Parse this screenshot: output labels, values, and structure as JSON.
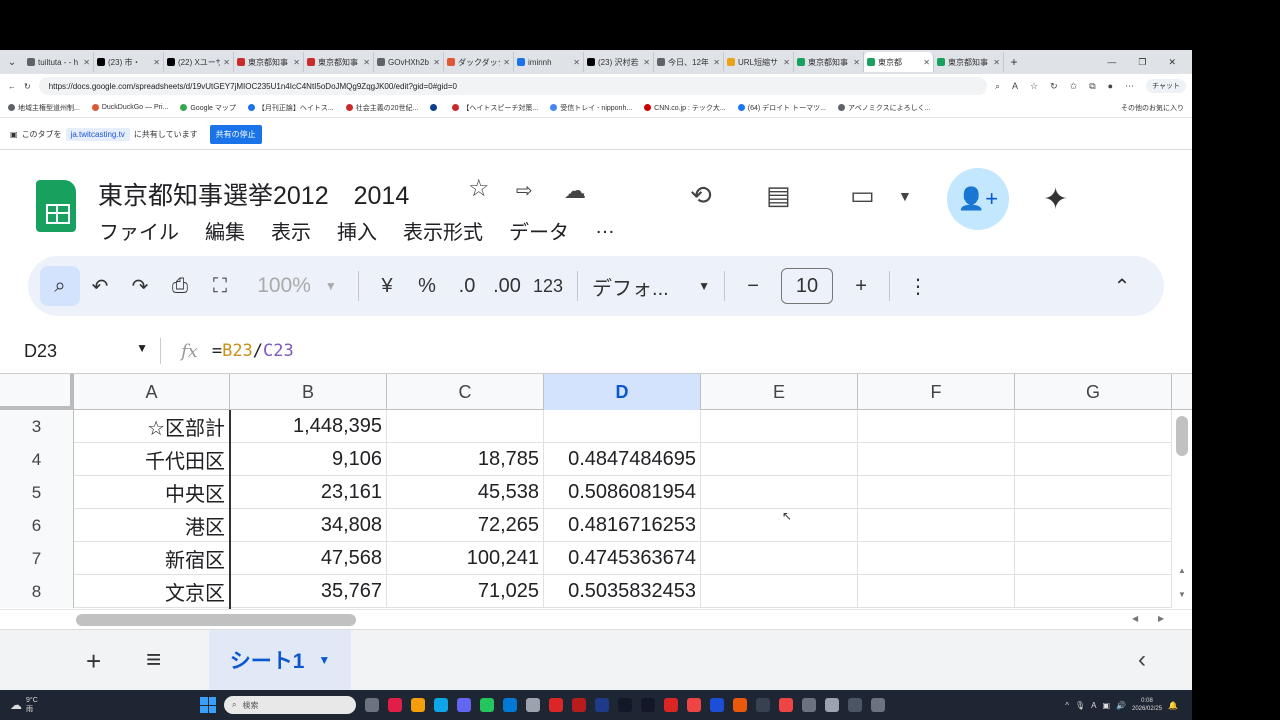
{
  "browser": {
    "tabs": [
      {
        "title": "tuiltuta - - h",
        "color": "#5f6368"
      },
      {
        "title": "(23) 市・",
        "color": "#000000"
      },
      {
        "title": "(22) Xユーザ",
        "color": "#000000"
      },
      {
        "title": "東京都知事",
        "color": "#c92a2a"
      },
      {
        "title": "東京都知事",
        "color": "#c92a2a"
      },
      {
        "title": "GOvHXh2b",
        "color": "#5f6368"
      },
      {
        "title": "ダックダックゴ",
        "color": "#de5833"
      },
      {
        "title": "iminnh",
        "color": "#1a73e8"
      },
      {
        "title": "(23) 沢村若",
        "color": "#000000"
      },
      {
        "title": "今日、12年",
        "color": "#5f6368"
      },
      {
        "title": "URL短縮サ",
        "color": "#e8a317"
      },
      {
        "title": "東京都知事",
        "color": "#18a15e"
      },
      {
        "title": "東京都",
        "color": "#18a15e",
        "active": true
      },
      {
        "title": "東京都知事",
        "color": "#18a15e"
      }
    ],
    "url": "https://docs.google.com/spreadsheets/d/19vUtGEY7jMIOC235U1n4IcC4NtI5oDoJMQg9ZqgJK00/edit?gid=0#gid=0",
    "chat_label": "チャット",
    "bookmarks": [
      {
        "label": "地域主権型道州制...",
        "color": "#5f6368"
      },
      {
        "label": "DuckDuckGo — Pri...",
        "color": "#de5833"
      },
      {
        "label": "Google マップ",
        "color": "#34a853"
      },
      {
        "label": "【月刊正論】ヘイトス...",
        "color": "#1a73e8"
      },
      {
        "label": "社会主義の20世紀...",
        "color": "#c92a2a"
      },
      {
        "label": "",
        "color": "#0b3d91"
      },
      {
        "label": "【ヘイトスピーチ対策...",
        "color": "#c92a2a"
      },
      {
        "label": "受信トレイ - nipponh...",
        "color": "#4285f4"
      },
      {
        "label": "CNN.co.jp : テック大...",
        "color": "#cc0000"
      },
      {
        "label": "(64) デロイト トーマツ...",
        "color": "#1877f2"
      },
      {
        "label": "アベノミクスによろしく...",
        "color": "#5f6368"
      }
    ],
    "bookmarks_more": "その他のお気に入り"
  },
  "sharing_bar": {
    "prefix": "このタブを",
    "host": "ja.twitcasting.tv",
    "suffix": "に共有しています",
    "stop_label": "共有の停止"
  },
  "sheets": {
    "title": "東京都知事選挙2012　2014",
    "menu": [
      "ファイル",
      "編集",
      "表示",
      "挿入",
      "表示形式",
      "データ",
      "…"
    ],
    "toolbar": {
      "zoom": "100%",
      "currency": "¥",
      "percent": "%",
      "dec_decrease": ".0",
      "dec_increase": ".00",
      "number_format": "123",
      "font": "デフォ...",
      "font_size": "10",
      "minus": "−",
      "plus": "+"
    },
    "name_box": "D23",
    "formula": {
      "eq": "=",
      "ref1": "B23",
      "op": "/",
      "ref2": "C23"
    },
    "columns": [
      "A",
      "B",
      "C",
      "D",
      "E",
      "F",
      "G"
    ],
    "selected_column": "D",
    "rows": [
      {
        "num": "3",
        "cells": [
          "☆区部計",
          "1,448,395",
          "",
          ""
        ]
      },
      {
        "num": "4",
        "cells": [
          "千代田区",
          "9,106",
          "18,785",
          "0.4847484695"
        ]
      },
      {
        "num": "5",
        "cells": [
          "中央区",
          "23,161",
          "45,538",
          "0.5086081954"
        ]
      },
      {
        "num": "6",
        "cells": [
          "港区",
          "34,808",
          "72,265",
          "0.4816716253"
        ]
      },
      {
        "num": "7",
        "cells": [
          "新宿区",
          "47,568",
          "100,241",
          "0.4745363674"
        ]
      },
      {
        "num": "8",
        "cells": [
          "文京区",
          "35,767",
          "71,025",
          "0.5035832453"
        ]
      }
    ],
    "sheet_tab": "シート1"
  },
  "taskbar": {
    "weather_temp": "9°C",
    "weather_text": "雨",
    "search_placeholder": "検索",
    "time": "0:08",
    "date": "2026/02/25",
    "ime": "A"
  }
}
